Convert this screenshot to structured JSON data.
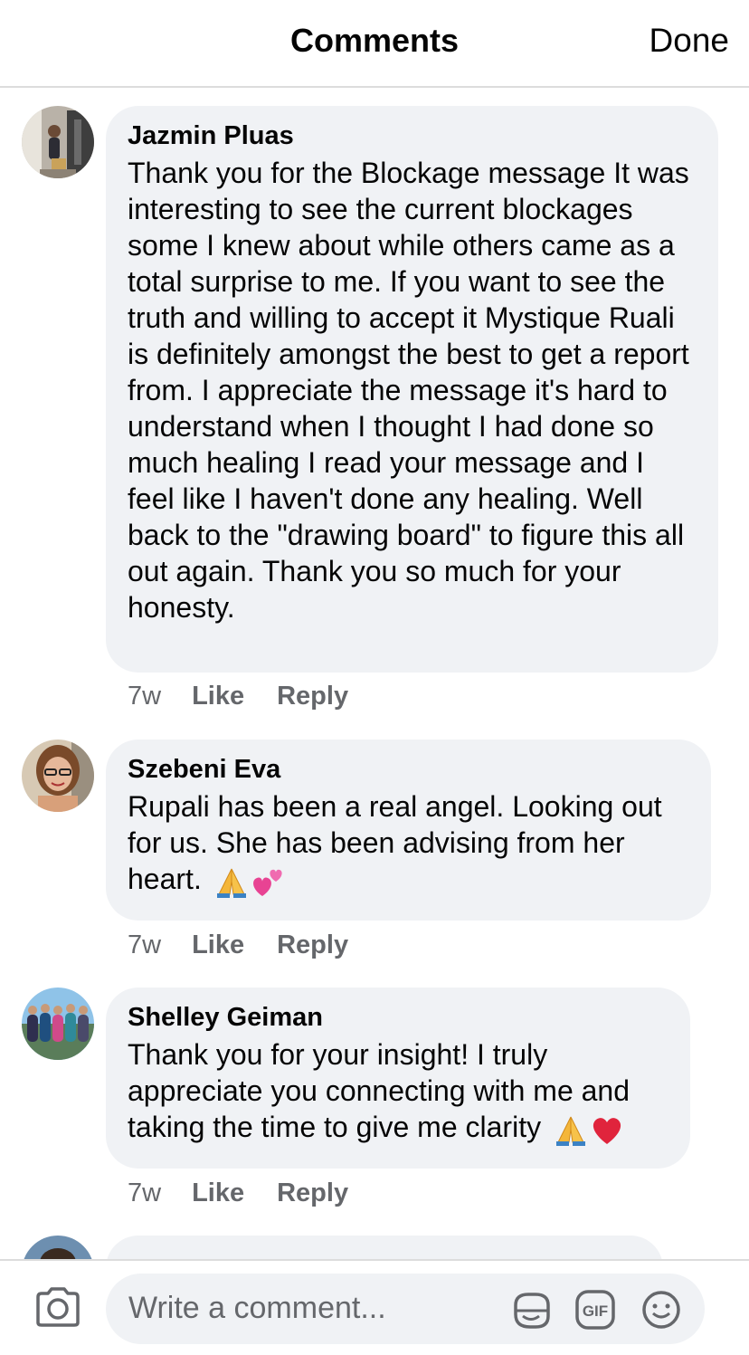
{
  "header": {
    "title": "Comments",
    "done_label": "Done"
  },
  "comments": [
    {
      "author": "Jazmin Pluas",
      "text": "Thank you for the Blockage message It was interesting to see the current blockages some I knew about while others came as a total surprise to me. If you want to see the truth and willing to accept it Mystique Ruali is definitely amongst the best to get a report from. I appreciate the message it's hard to understand when I thought I had done so much healing I read your message and I feel like I haven't done any healing. Well back to the \"drawing board\" to figure this all out again. Thank you so much for your honesty.",
      "time": "7w",
      "like_label": "Like",
      "reply_label": "Reply"
    },
    {
      "author": "Szebeni Eva",
      "text": "Rupali has been a real angel. Looking out for us. She has been advising from her heart.",
      "emojis": [
        "folded-hands",
        "two-hearts"
      ],
      "time": "7w",
      "like_label": "Like",
      "reply_label": "Reply"
    },
    {
      "author": "Shelley Geiman",
      "text": "Thank you for your insight! I truly appreciate you connecting with me and taking the time to give me clarity",
      "emojis": [
        "folded-hands",
        "red-heart"
      ],
      "time": "7w",
      "like_label": "Like",
      "reply_label": "Reply"
    }
  ],
  "composer": {
    "placeholder": "Write a comment...",
    "icons": [
      "camera-icon",
      "sticker-icon",
      "gif-icon",
      "emoji-icon"
    ],
    "gif_label": "GIF"
  },
  "colors": {
    "bubble": "#f0f2f5",
    "meta": "#65676b",
    "text": "#050505",
    "heart": "#e0245e"
  }
}
